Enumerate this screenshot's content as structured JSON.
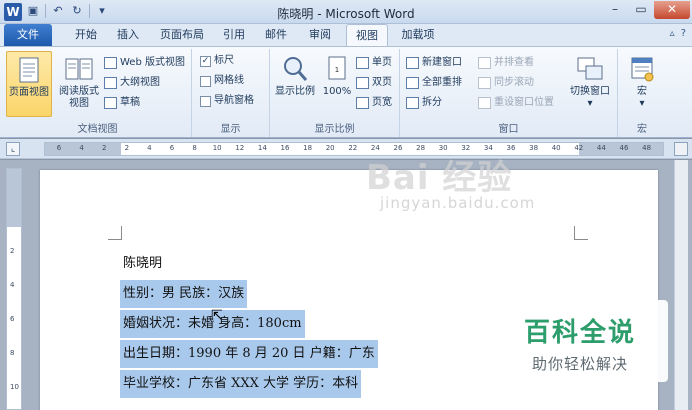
{
  "window": {
    "title": "陈晓明 - Microsoft Word",
    "app_icon_letter": "W",
    "controls": [
      "–",
      "▭",
      "✕"
    ]
  },
  "qat": [
    "save-icon",
    "undo-icon",
    "redo-icon",
    "customize-icon"
  ],
  "tabs": {
    "file": "文件",
    "items": [
      "开始",
      "插入",
      "页面布局",
      "引用",
      "邮件",
      "审阅",
      "视图",
      "加载项"
    ],
    "active": "视图"
  },
  "ribbon": {
    "doc_views": {
      "label": "文档视图",
      "print_layout": "页面视图",
      "full_screen_line1": "阅读版式",
      "full_screen_line2": "视图",
      "web_layout": "Web 版式视图",
      "outline": "大纲视图",
      "draft": "草稿"
    },
    "show": {
      "label": "显示",
      "ruler": "标尺",
      "ruler_checked": true,
      "gridlines": "网格线",
      "gridlines_checked": false,
      "nav_pane": "导航窗格",
      "nav_pane_checked": false
    },
    "zoom": {
      "label": "显示比例",
      "zoom_button": "显示比例",
      "hundred": "100%",
      "one_page": "单页",
      "two_pages": "双页",
      "page_width": "页宽"
    },
    "window": {
      "label": "窗口",
      "new_window": "新建窗口",
      "arrange_all": "全部重排",
      "split": "拆分",
      "side_by_side": "并排查看",
      "sync_scroll": "同步滚动",
      "reset_position": "重设窗口位置",
      "switch_windows": "切换窗口"
    },
    "macros": {
      "label": "宏",
      "button": "宏"
    }
  },
  "ruler_ticks": [
    "6",
    "4",
    "2",
    "2",
    "4",
    "6",
    "8",
    "10",
    "12",
    "14",
    "16",
    "18",
    "20",
    "22",
    "24",
    "26",
    "28",
    "30",
    "32",
    "34",
    "36",
    "38",
    "40",
    "42",
    "44",
    "46",
    "48"
  ],
  "vruler_ticks": [
    "2",
    "4",
    "6",
    "8",
    "10"
  ],
  "document": {
    "lines": [
      "陈晓明",
      "性别：男  民族：汉族",
      "婚姻状况：未婚  身高：180cm",
      "出生日期：1990 年 8 月 20 日   户籍：广东",
      "毕业学校：广东省 XXX 大学  学历：本科"
    ]
  },
  "watermark": {
    "baidu": "Bai 经验",
    "baidu_url": "jingyan.baidu.com",
    "title": "百科全说",
    "subtitle": "助你轻松解决"
  }
}
